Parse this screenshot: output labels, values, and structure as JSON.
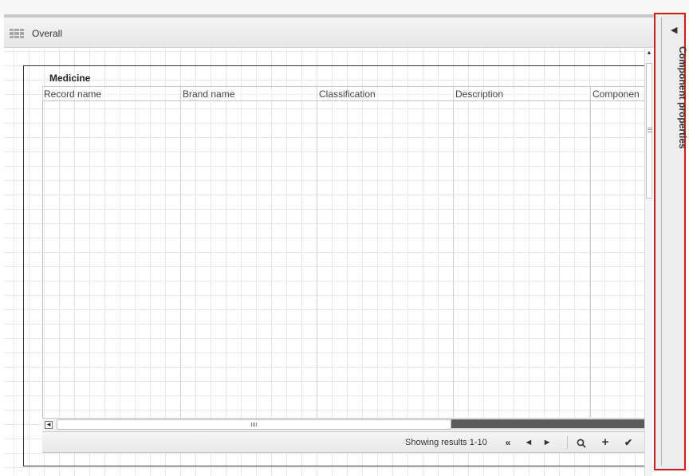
{
  "header": {
    "title": "Overall",
    "icon": "grid-icon"
  },
  "panel": {
    "title": "Medicine",
    "columns": [
      {
        "label": "Record name"
      },
      {
        "label": "Brand name"
      },
      {
        "label": "Classification"
      },
      {
        "label": "Description"
      },
      {
        "label": "Componen"
      }
    ]
  },
  "footer": {
    "results_text": "Showing results 1-10",
    "icons": [
      "first-page-icon",
      "previous-page-icon",
      "next-page-icon",
      "search-icon",
      "add-icon",
      "checkmark-icon"
    ]
  },
  "side_panel": {
    "label": "Component properties",
    "collapse_icon": "collapse-arrow-icon"
  },
  "colors": {
    "highlight_border": "#e01818",
    "grid_line": "#e8e8e8",
    "frame": "#333333"
  }
}
